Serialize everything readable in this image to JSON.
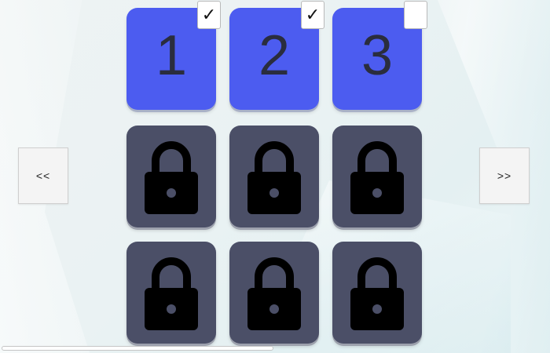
{
  "navigation": {
    "prev_label": "<<",
    "next_label": ">>"
  },
  "levels": [
    {
      "label": "1",
      "state": "unlocked",
      "completed": true,
      "check_mark": "✓"
    },
    {
      "label": "2",
      "state": "unlocked",
      "completed": true,
      "check_mark": "✓"
    },
    {
      "label": "3",
      "state": "unlocked",
      "completed": false,
      "check_mark": ""
    },
    {
      "state": "locked",
      "icon": "lock-icon"
    },
    {
      "state": "locked",
      "icon": "lock-icon"
    },
    {
      "state": "locked",
      "icon": "lock-icon"
    },
    {
      "state": "locked",
      "icon": "lock-icon"
    },
    {
      "state": "locked",
      "icon": "lock-icon"
    },
    {
      "state": "locked",
      "icon": "lock-icon"
    }
  ],
  "colors": {
    "unlocked_tile": "#4c5cf0",
    "locked_tile": "#4b4f67",
    "number_text": "#2a2d3e"
  },
  "scrollbar": {
    "horizontal_position_fraction": 0.0,
    "visible_fraction": 0.5
  }
}
